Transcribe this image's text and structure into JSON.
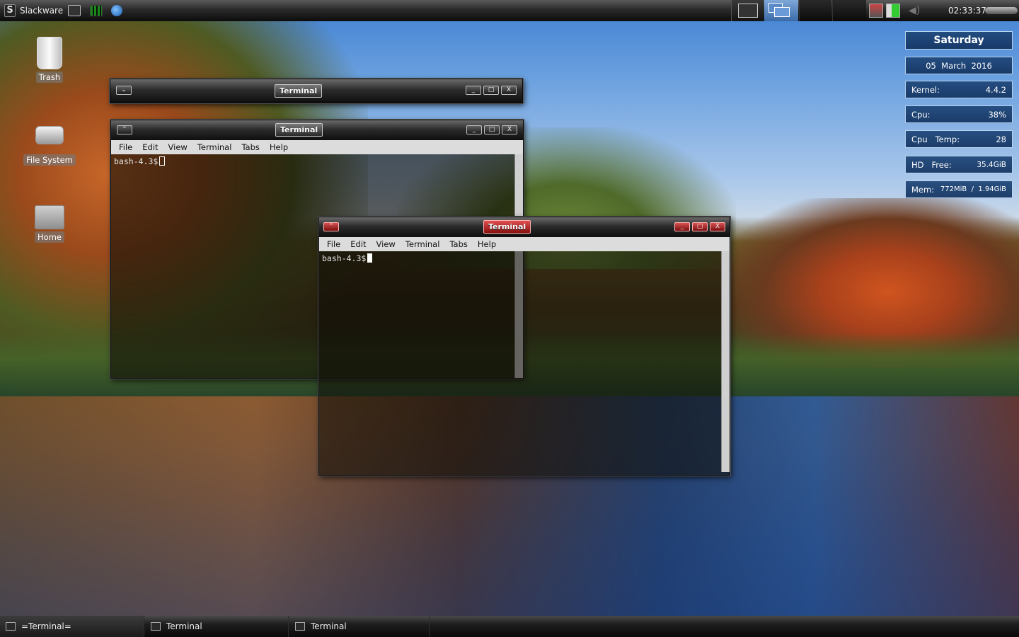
{
  "top_panel": {
    "menu_label": "Slackware",
    "launchers": [
      "terminal-icon",
      "system-monitor-icon",
      "browser-icon"
    ],
    "clock": "02:33:37 PM"
  },
  "desktop_icons": [
    {
      "label": "Trash",
      "icon": "trash-icon"
    },
    {
      "label": "File System",
      "icon": "hard-drive-icon"
    },
    {
      "label": "Home",
      "icon": "home-folder-icon"
    }
  ],
  "conky": {
    "day": "Saturday",
    "date": "05  March  2016",
    "kernel_label": "Kernel:",
    "kernel_value": "4.4.2",
    "cpu_label": "Cpu:",
    "cpu_value": "38%",
    "cputemp_label": "Cpu   Temp:",
    "cputemp_value": "28",
    "hd_label": "HD   Free:",
    "hd_value": "35.4GiB",
    "mem_label": "Mem:",
    "mem_value": "772MiB  /  1.94GiB"
  },
  "windows": [
    {
      "title": "Terminal",
      "shaded": true
    },
    {
      "title": "Terminal",
      "prompt": "bash-4.3$"
    },
    {
      "title": "Terminal",
      "prompt": "bash-4.3$",
      "active": true
    }
  ],
  "menu": [
    "File",
    "Edit",
    "View",
    "Terminal",
    "Tabs",
    "Help"
  ],
  "window_buttons": {
    "min": "_",
    "max": "□",
    "close": "X"
  },
  "taskbar": [
    "=Terminal=",
    "Terminal",
    "Terminal"
  ],
  "colors": {
    "active_title": "#c21a1a",
    "conky_border": "#b9d4ee"
  }
}
